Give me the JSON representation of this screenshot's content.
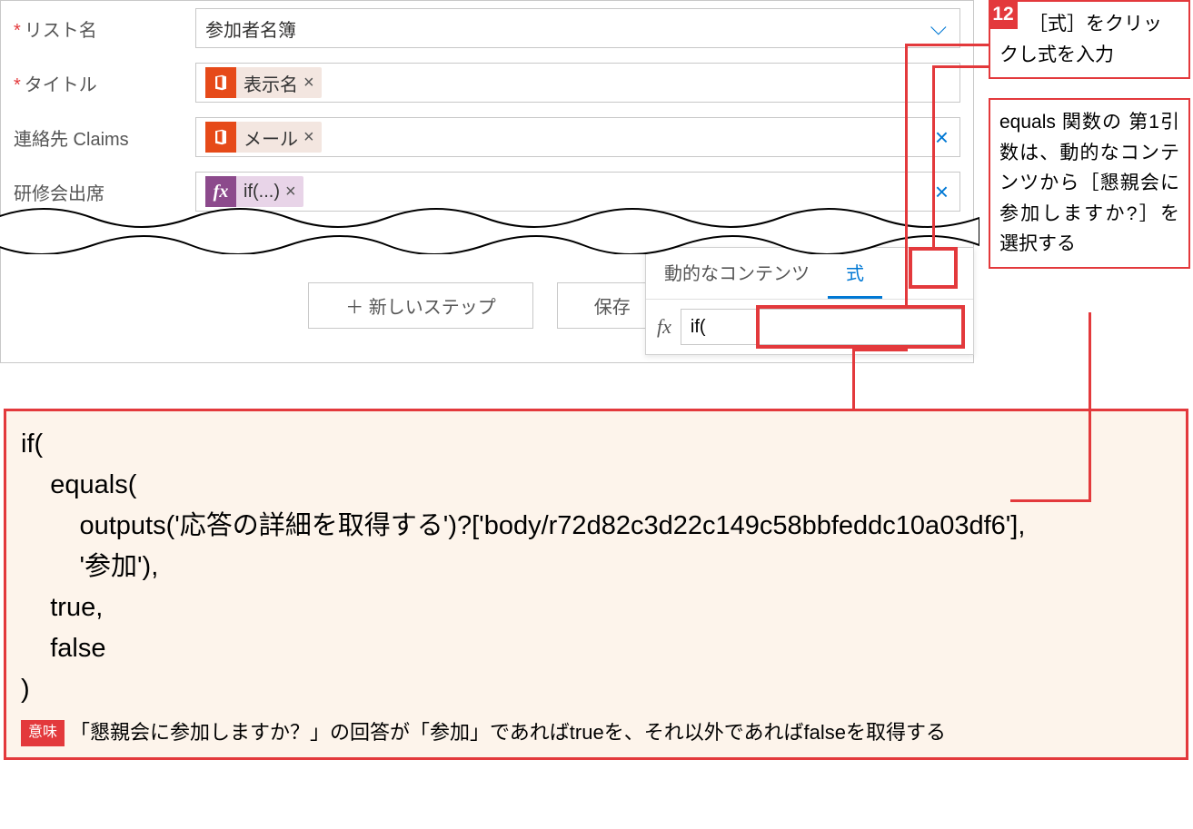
{
  "form": {
    "list_name": {
      "label": "リスト名",
      "value": "参加者名簿"
    },
    "title": {
      "label": "タイトル",
      "token": "表示名",
      "remove": "×"
    },
    "claims": {
      "label": "連絡先 Claims",
      "token": "メール",
      "remove": "×"
    },
    "attendance": {
      "label": "研修会出席",
      "token": "if(...)",
      "remove": "×"
    }
  },
  "actions": {
    "new_step": "＋ 新しいステップ",
    "save": "保存"
  },
  "expr": {
    "tab_dynamic": "動的なコンテンツ",
    "tab_formula": "式",
    "fx": "fx",
    "input": "if("
  },
  "annotations": {
    "step12_num": "12",
    "step12_text": "［式］をクリックし式を入力",
    "note_text": "equals 関数の 第1引 数は、動的なコンテンツから［懇親会に参加しますか?］を選択する"
  },
  "code": {
    "body": "if(\n    equals(\n        outputs('応答の詳細を取得する')?['body/r72d82c3d22c149c58bbfeddc10a03df6'],\n        '参加'),\n    true,\n    false\n)",
    "meaning_label": "意味",
    "meaning_text": "「懇親会に参加しますか？」の回答が「参加」であればtrueを、それ以外であればfalseを取得する"
  }
}
